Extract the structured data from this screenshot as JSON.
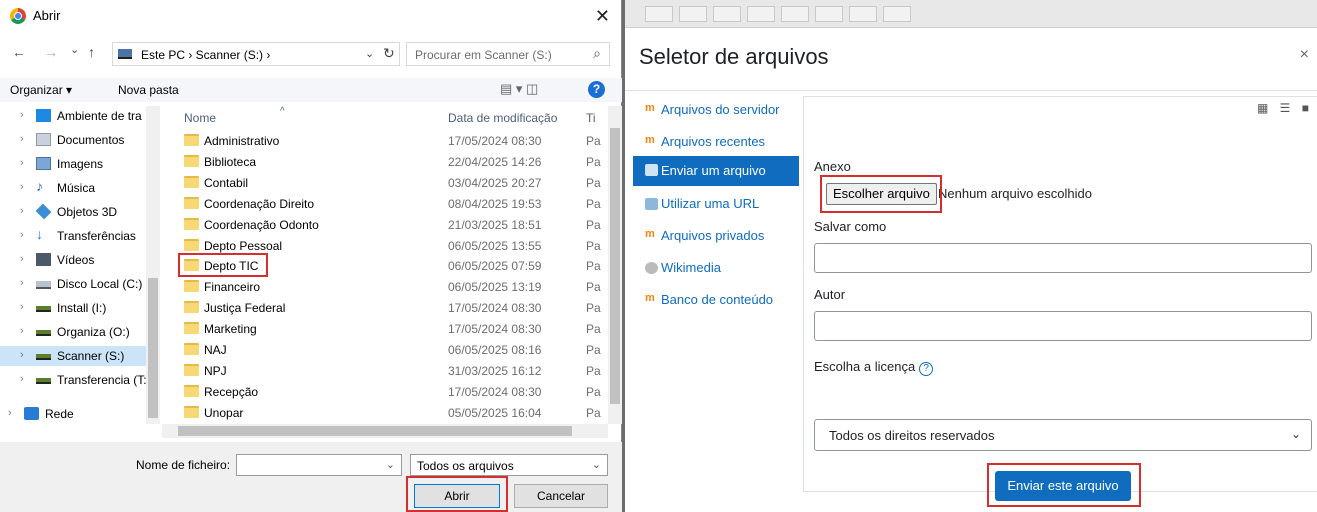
{
  "win_dialog": {
    "title": "Abrir",
    "close_glyph": "✕",
    "nav": {
      "back": "←",
      "forward": "→",
      "recent": "⌄",
      "up": "↑"
    },
    "breadcrumb": "Este PC  ›  Scanner (S:)  ›",
    "breadcrumb_chevron": "⌄",
    "refresh_glyph": "↻",
    "search_placeholder": "Procurar em Scanner (S:)",
    "search_glyph": "⌕",
    "toolbar": {
      "organize": "Organizar ▾",
      "new_folder": "Nova pasta",
      "view_glyphs": "▤ ▾   ◫",
      "help": "?"
    },
    "nav_pane": [
      {
        "label": "Ambiente de tra",
        "icon": "desktop-icon",
        "color": "#1e88e5"
      },
      {
        "label": "Documentos",
        "icon": "documents-icon",
        "color": "#9aa6b2"
      },
      {
        "label": "Imagens",
        "icon": "images-icon",
        "color": "#7aa7d6"
      },
      {
        "label": "Música",
        "icon": "music-icon",
        "color": "#1e6fc9"
      },
      {
        "label": "Objetos 3D",
        "icon": "objects-3d-icon",
        "color": "#3b8ed6"
      },
      {
        "label": "Transferências",
        "icon": "downloads-icon",
        "color": "#2a7bd3"
      },
      {
        "label": "Vídeos",
        "icon": "videos-icon",
        "color": "#4a5a6a"
      },
      {
        "label": "Disco Local (C:)",
        "icon": "local-disk-icon",
        "color": "#8a9aa8"
      },
      {
        "label": "Install (I:)",
        "icon": "network-drive-icon",
        "color": "#5b7f2a"
      },
      {
        "label": "Organiza (O:)",
        "icon": "network-drive-icon",
        "color": "#5b7f2a"
      },
      {
        "label": "Scanner (S:)",
        "icon": "network-drive-icon",
        "color": "#5b7f2a",
        "selected": true
      },
      {
        "label": "Transferencia (T:",
        "icon": "network-drive-icon",
        "color": "#5b7f2a"
      },
      {
        "label": "Rede",
        "icon": "network-icon",
        "color": "#2a7bd3"
      }
    ],
    "columns": {
      "name": "Nome",
      "modified": "Data de modificação",
      "type": "Ti"
    },
    "files": [
      {
        "name": "Administrativo",
        "modified": "17/05/2024 08:30",
        "type": "Pa"
      },
      {
        "name": "Biblioteca",
        "modified": "22/04/2025 14:26",
        "type": "Pa"
      },
      {
        "name": "Contabil",
        "modified": "03/04/2025 20:27",
        "type": "Pa"
      },
      {
        "name": "Coordenação Direito",
        "modified": "08/04/2025 19:53",
        "type": "Pa"
      },
      {
        "name": "Coordenação Odonto",
        "modified": "21/03/2025 18:51",
        "type": "Pa"
      },
      {
        "name": "Depto Pessoal",
        "modified": "06/05/2025 13:55",
        "type": "Pa"
      },
      {
        "name": "Depto TIC",
        "modified": "06/05/2025 07:59",
        "type": "Pa"
      },
      {
        "name": "Financeiro",
        "modified": "06/05/2025 13:19",
        "type": "Pa"
      },
      {
        "name": "Justiça Federal",
        "modified": "17/05/2024 08:30",
        "type": "Pa"
      },
      {
        "name": "Marketing",
        "modified": "17/05/2024 08:30",
        "type": "Pa"
      },
      {
        "name": "NAJ",
        "modified": "06/05/2025 08:16",
        "type": "Pa"
      },
      {
        "name": "NPJ",
        "modified": "31/03/2025 16:12",
        "type": "Pa"
      },
      {
        "name": "Recepção",
        "modified": "17/05/2024 08:30",
        "type": "Pa"
      },
      {
        "name": "Unopar",
        "modified": "05/05/2025 16:04",
        "type": "Pa"
      }
    ],
    "filename_label": "Nome de ficheiro:",
    "filename_value": "",
    "filetype_value": "Todos os arquivos",
    "open_button": "Abrir",
    "cancel_button": "Cancelar"
  },
  "moodle": {
    "title": "Seletor de arquivos",
    "close_glyph": "×",
    "repositories": [
      {
        "label": "Arquivos do servidor",
        "icon": "moodle-icon"
      },
      {
        "label": "Arquivos recentes",
        "icon": "moodle-icon"
      },
      {
        "label": "Enviar um arquivo",
        "icon": "upload-icon",
        "active": true
      },
      {
        "label": "Utilizar uma URL",
        "icon": "url-icon"
      },
      {
        "label": "Arquivos privados",
        "icon": "moodle-icon"
      },
      {
        "label": "Wikimedia",
        "icon": "wikimedia-icon"
      },
      {
        "label": "Banco de conteúdo",
        "icon": "moodle-icon"
      }
    ],
    "view_glyphs": "▦ ☰ ■",
    "attachment_label": "Anexo",
    "choose_file_button": "Escolher arquivo",
    "no_file_text": "Nenhum arquivo escolhido",
    "save_as_label": "Salvar como",
    "save_as_value": "",
    "author_label": "Autor",
    "author_value": "",
    "license_label": "Escolha a licença",
    "license_help": "?",
    "license_value": "Todos os direitos reservados",
    "license_dropdown_glyph": "⌄",
    "submit_button": "Enviar este arquivo",
    "accent": "#0f6cbf"
  },
  "highlight_color": "#d32f2f"
}
